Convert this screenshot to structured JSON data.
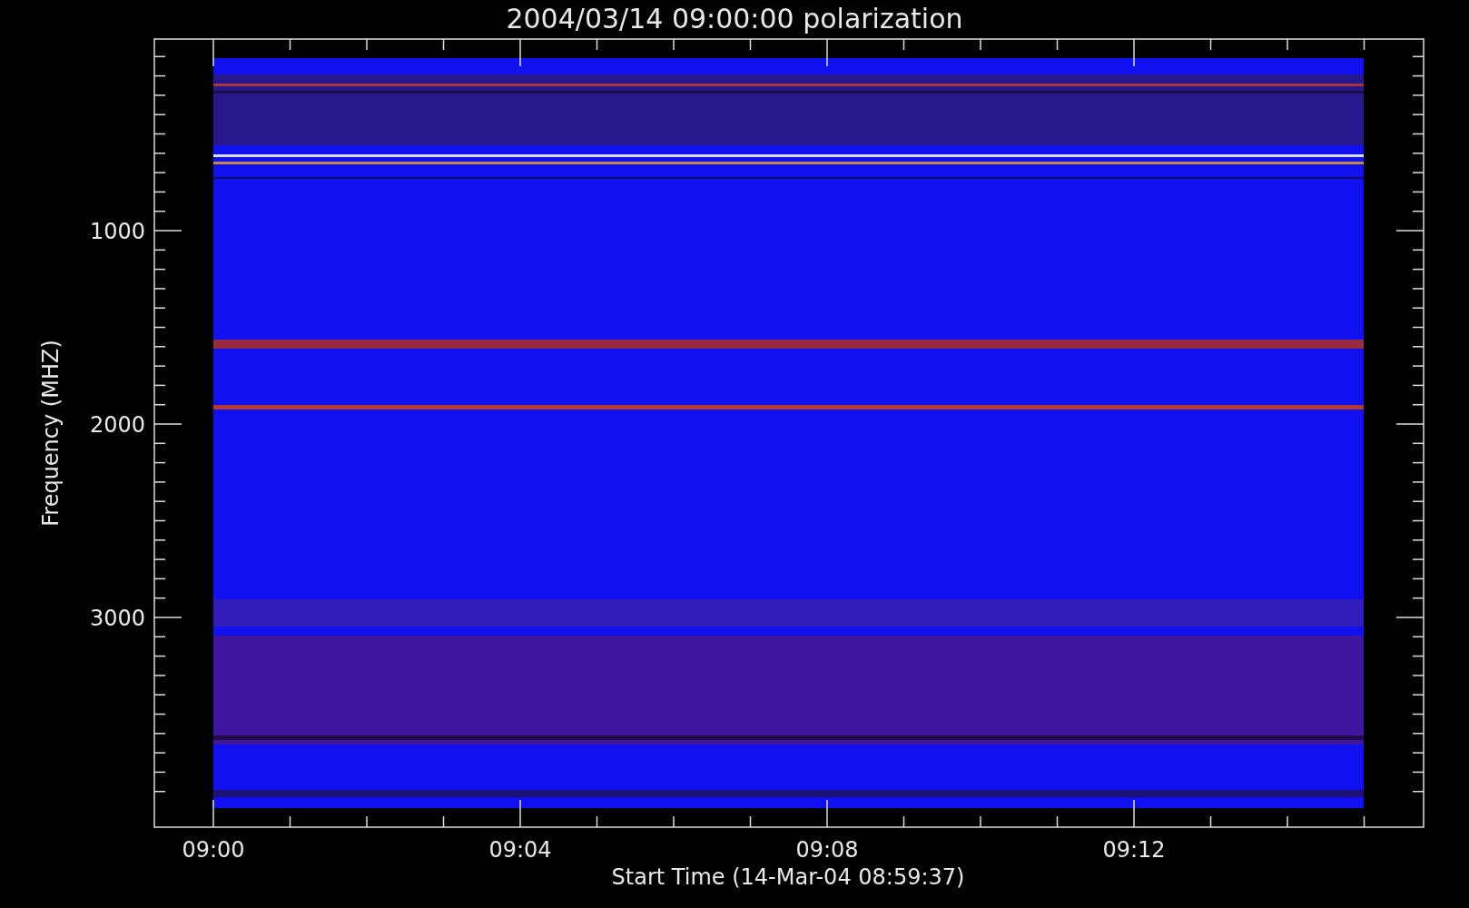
{
  "title": "2004/03/14 09:00:00 polarization",
  "plot": {
    "ylabel": "Frequency (MHZ)",
    "xlabel": "Start Time (14-Mar-04 08:59:37)",
    "yticks": [
      "1000",
      "2000",
      "3000"
    ],
    "xticks": [
      "09:00",
      "09:04",
      "09:08",
      "09:12"
    ]
  }
}
